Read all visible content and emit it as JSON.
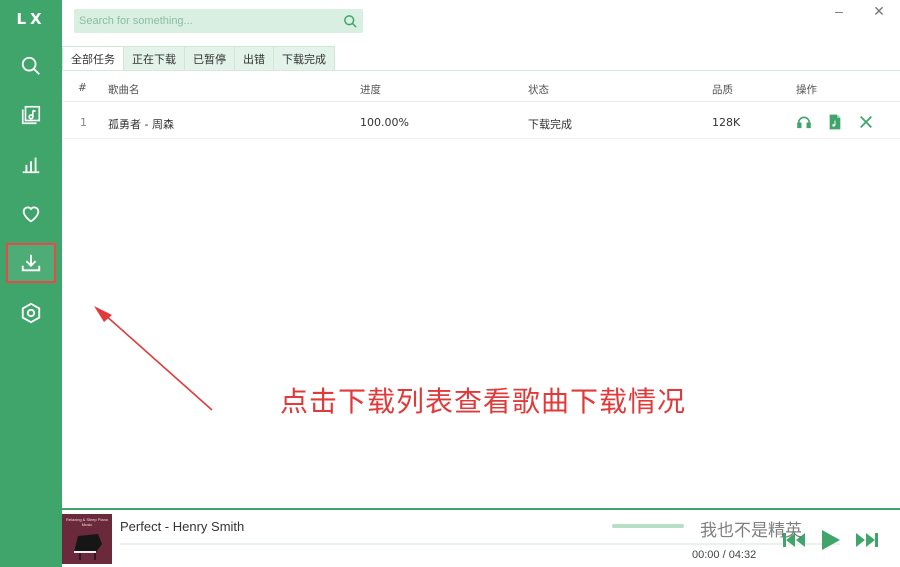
{
  "app": {
    "logo": "LX"
  },
  "sidebar": {
    "items": [
      {
        "icon": "search-icon"
      },
      {
        "icon": "music-library-icon"
      },
      {
        "icon": "chart-icon"
      },
      {
        "icon": "heart-icon"
      },
      {
        "icon": "download-icon",
        "active": true
      },
      {
        "icon": "settings-icon"
      }
    ]
  },
  "window": {
    "minimize": "–",
    "close": "✕"
  },
  "search": {
    "placeholder": "Search for something..."
  },
  "tabs": [
    "全部任务",
    "正在下载",
    "已暂停",
    "出错",
    "下载完成"
  ],
  "table": {
    "headers": {
      "num": "#",
      "name": "歌曲名",
      "progress": "进度",
      "status": "状态",
      "quality": "品质",
      "actions": "操作"
    },
    "rows": [
      {
        "num": "1",
        "name": "孤勇者 - 周森",
        "progress": "100.00%",
        "status": "下载完成",
        "quality": "128K"
      }
    ]
  },
  "annotation": "点击下载列表查看歌曲下载情况",
  "player": {
    "cover_text": "Relaxing & Sleep Piano Music",
    "title": "Perfect - Henry Smith",
    "time": "00:00 / 04:32"
  },
  "watermark": "我也不是精英",
  "colors": {
    "accent": "#3fa56b",
    "highlight": "#e84a4a",
    "annotation": "#e03a3a"
  }
}
